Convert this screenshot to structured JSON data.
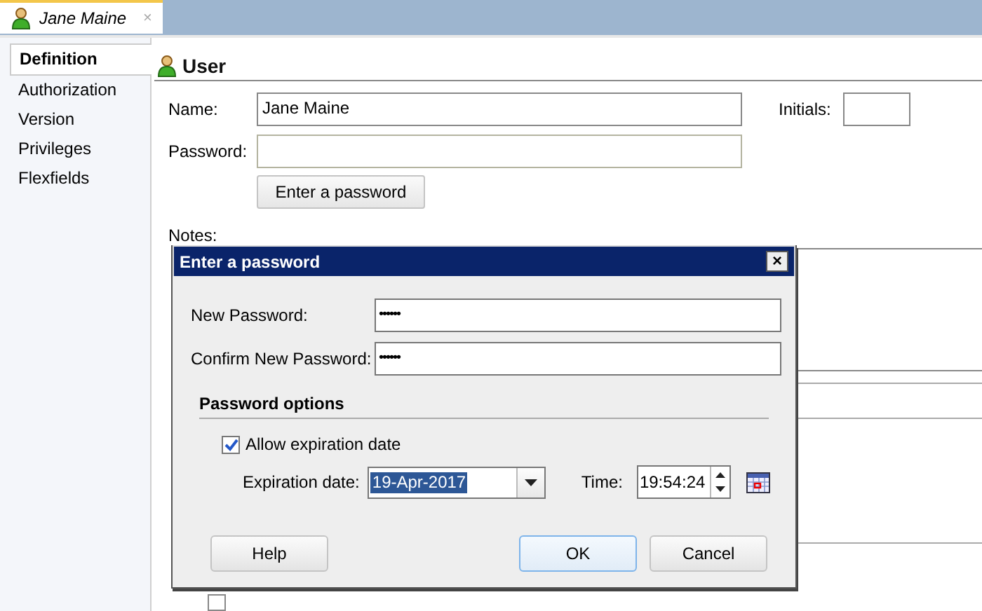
{
  "editor_tab": {
    "label": "Jane Maine",
    "close": "×",
    "selected": true
  },
  "sidebar": {
    "items": [
      {
        "label": "Definition",
        "selected": true
      },
      {
        "label": "Authorization",
        "selected": false
      },
      {
        "label": "Version",
        "selected": false
      },
      {
        "label": "Privileges",
        "selected": false
      },
      {
        "label": "Flexfields",
        "selected": false
      }
    ]
  },
  "user_form": {
    "heading": "User",
    "name_label": "Name:",
    "name_value": "Jane Maine",
    "initials_label": "Initials:",
    "password_label": "Password:",
    "enter_password_button": "Enter a password",
    "notes_label": "Notes:",
    "lower_checkbox": {
      "checked": false
    }
  },
  "dialog": {
    "title": "Enter a password",
    "close": "×",
    "new_password_label": "New Password:",
    "new_password_value": "••••••",
    "confirm_label": "Confirm New Password:",
    "confirm_value": "••••••",
    "options_heading": "Password options",
    "allow_expiration": {
      "label": "Allow expiration date",
      "checked": true
    },
    "expiration_label": "Expiration date:",
    "expiration_value": "19-Apr-2017",
    "time_label": "Time:",
    "time_value": "19:54:24",
    "buttons": [
      {
        "label": "Help",
        "default": false
      },
      {
        "label": "OK",
        "default": true
      },
      {
        "label": "Cancel",
        "default": false
      }
    ]
  }
}
